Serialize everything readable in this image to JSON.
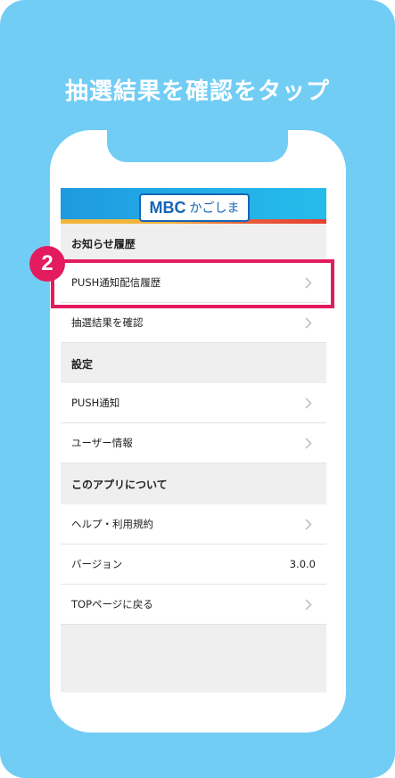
{
  "heading": "抽選結果を確認をタップ",
  "logo": {
    "brand": "MBC",
    "kana": "かごしま"
  },
  "step_badge": "2",
  "sections": [
    {
      "header": "お知らせ履歴",
      "items": [
        {
          "label": "PUSH通知配信履歴"
        },
        {
          "label": "抽選結果を確認"
        }
      ]
    },
    {
      "header": "設定",
      "items": [
        {
          "label": "PUSH通知"
        },
        {
          "label": "ユーザー情報"
        }
      ]
    },
    {
      "header": "このアプリについて",
      "items": [
        {
          "label": "ヘルプ・利用規約"
        },
        {
          "label": "バージョン",
          "value": "3.0.0"
        },
        {
          "label": "TOPページに戻る"
        }
      ]
    }
  ],
  "colors": {
    "background": "#72CDF5",
    "highlight": "#E31C5F",
    "logo_blue": "#1565B6"
  }
}
